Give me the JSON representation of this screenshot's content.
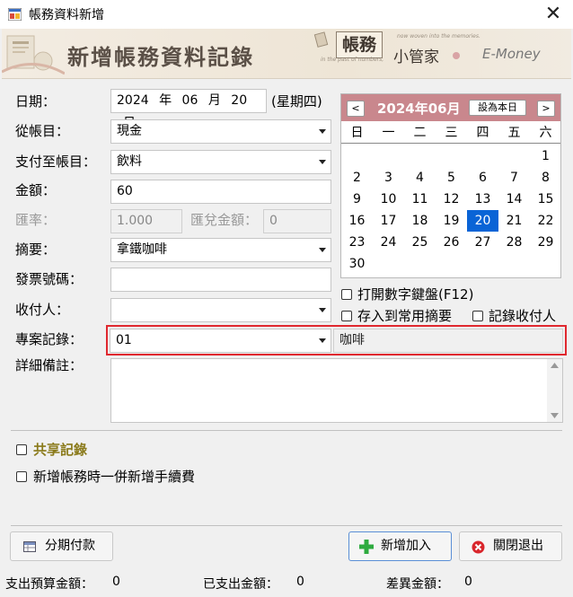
{
  "window": {
    "title": "帳務資料新增",
    "close_glyph": "✕"
  },
  "banner": {
    "title": "新增帳務資料記錄",
    "brand_tag": "帳務",
    "brand_sub": "小管家",
    "brand_en": "E-Money",
    "tagline_1": "now woven into the memories.",
    "tagline_2": "in the past of numbers,"
  },
  "form": {
    "date_label": "日期：",
    "date_year": "2024",
    "date_year_unit": "年",
    "date_month": "06",
    "date_month_unit": "月",
    "date_day": "20",
    "date_day_unit": "日",
    "weekday": "(星期四)",
    "from_label": "從帳目：",
    "from_value": "現金",
    "to_label": "支付至帳目：",
    "to_value": "飲料",
    "amount_label": "金額：",
    "amount_value": "60",
    "rate_label": "匯率：",
    "rate_value": "1.000",
    "exch_label": "匯兌金額：",
    "exch_value": "0",
    "summary_label": "摘要：",
    "summary_value": "拿鐵咖啡",
    "invoice_label": "發票號碼：",
    "invoice_value": "",
    "payee_label": "收付人：",
    "payee_value": "",
    "project_label": "專案記錄：",
    "project_value": "01",
    "project_name": "咖啡",
    "notes_label": "詳細備註：",
    "notes_value": ""
  },
  "calendar": {
    "prev": "<",
    "next": ">",
    "month_title": "2024年06月",
    "today_button": "設為本日",
    "weekdays": [
      "日",
      "一",
      "二",
      "三",
      "四",
      "五",
      "六"
    ],
    "days": [
      "1",
      "2",
      "3",
      "4",
      "5",
      "6",
      "7",
      "8",
      "9",
      "10",
      "11",
      "12",
      "13",
      "14",
      "15",
      "16",
      "17",
      "18",
      "19",
      "20",
      "21",
      "22",
      "23",
      "24",
      "25",
      "26",
      "27",
      "28",
      "29",
      "30"
    ],
    "first_weekday_index": 6,
    "selected_day": "20",
    "selected_color": "#0a64d6",
    "header_color": "#c9878d"
  },
  "options": {
    "keypad": "打開數字鍵盤(F12)",
    "save_summary": "存入到常用摘要",
    "record_payee": "記錄收付人",
    "shared": "共享記錄",
    "add_fee": "新增帳務時一併新增手續費"
  },
  "buttons": {
    "installment": "分期付款",
    "add": "新增加入",
    "close": "關閉退出"
  },
  "status": {
    "budget_label": "支出預算金額：",
    "budget_value": "0",
    "spent_label": "已支出金額：",
    "spent_value": "0",
    "diff_label": "差異金額：",
    "diff_value": "0"
  }
}
